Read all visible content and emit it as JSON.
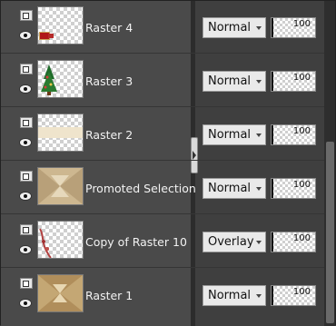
{
  "layers": [
    {
      "name": "Raster 4",
      "blend": "Normal",
      "opacity": "100",
      "thumb": "raster4"
    },
    {
      "name": "Raster 3",
      "blend": "Normal",
      "opacity": "100",
      "thumb": "raster3"
    },
    {
      "name": "Raster 2",
      "blend": "Normal",
      "opacity": "100",
      "thumb": "raster2"
    },
    {
      "name": "Promoted Selection",
      "blend": "Normal",
      "opacity": "100",
      "thumb": "promoted"
    },
    {
      "name": "Copy of Raster 10",
      "blend": "Overlay",
      "opacity": "100",
      "thumb": "copy10"
    },
    {
      "name": "Raster 1",
      "blend": "Normal",
      "opacity": "100",
      "thumb": "raster1"
    }
  ],
  "icons": {
    "layer_props": "layer-properties-icon",
    "visibility": "eye-icon",
    "dropdown": "chevron-down-icon"
  },
  "colors": {
    "panel_bg": "#454545",
    "text": "#f2f2f2",
    "field_bg": "#e9e9e9"
  }
}
